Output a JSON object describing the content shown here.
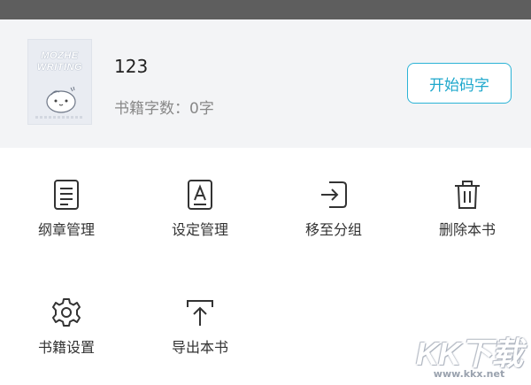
{
  "book": {
    "cover_title": "MOZHE\nWRITING",
    "name": "123",
    "word_count": "书籍字数：0字",
    "start_button": "开始码字"
  },
  "actions": [
    {
      "label": "纲章管理",
      "icon": "outline-document-icon"
    },
    {
      "label": "设定管理",
      "icon": "settings-letter-a-icon"
    },
    {
      "label": "移至分组",
      "icon": "move-to-group-icon"
    },
    {
      "label": "删除本书",
      "icon": "trash-icon"
    },
    {
      "label": "书籍设置",
      "icon": "gear-icon"
    },
    {
      "label": "导出本书",
      "icon": "export-upload-icon"
    }
  ],
  "watermark": {
    "brand": "KK下载",
    "url": "www.kkx.net"
  },
  "colors": {
    "accent": "#2bb3d6",
    "header_bg": "#f3f4f6",
    "status_bar": "#5e5e5e"
  }
}
